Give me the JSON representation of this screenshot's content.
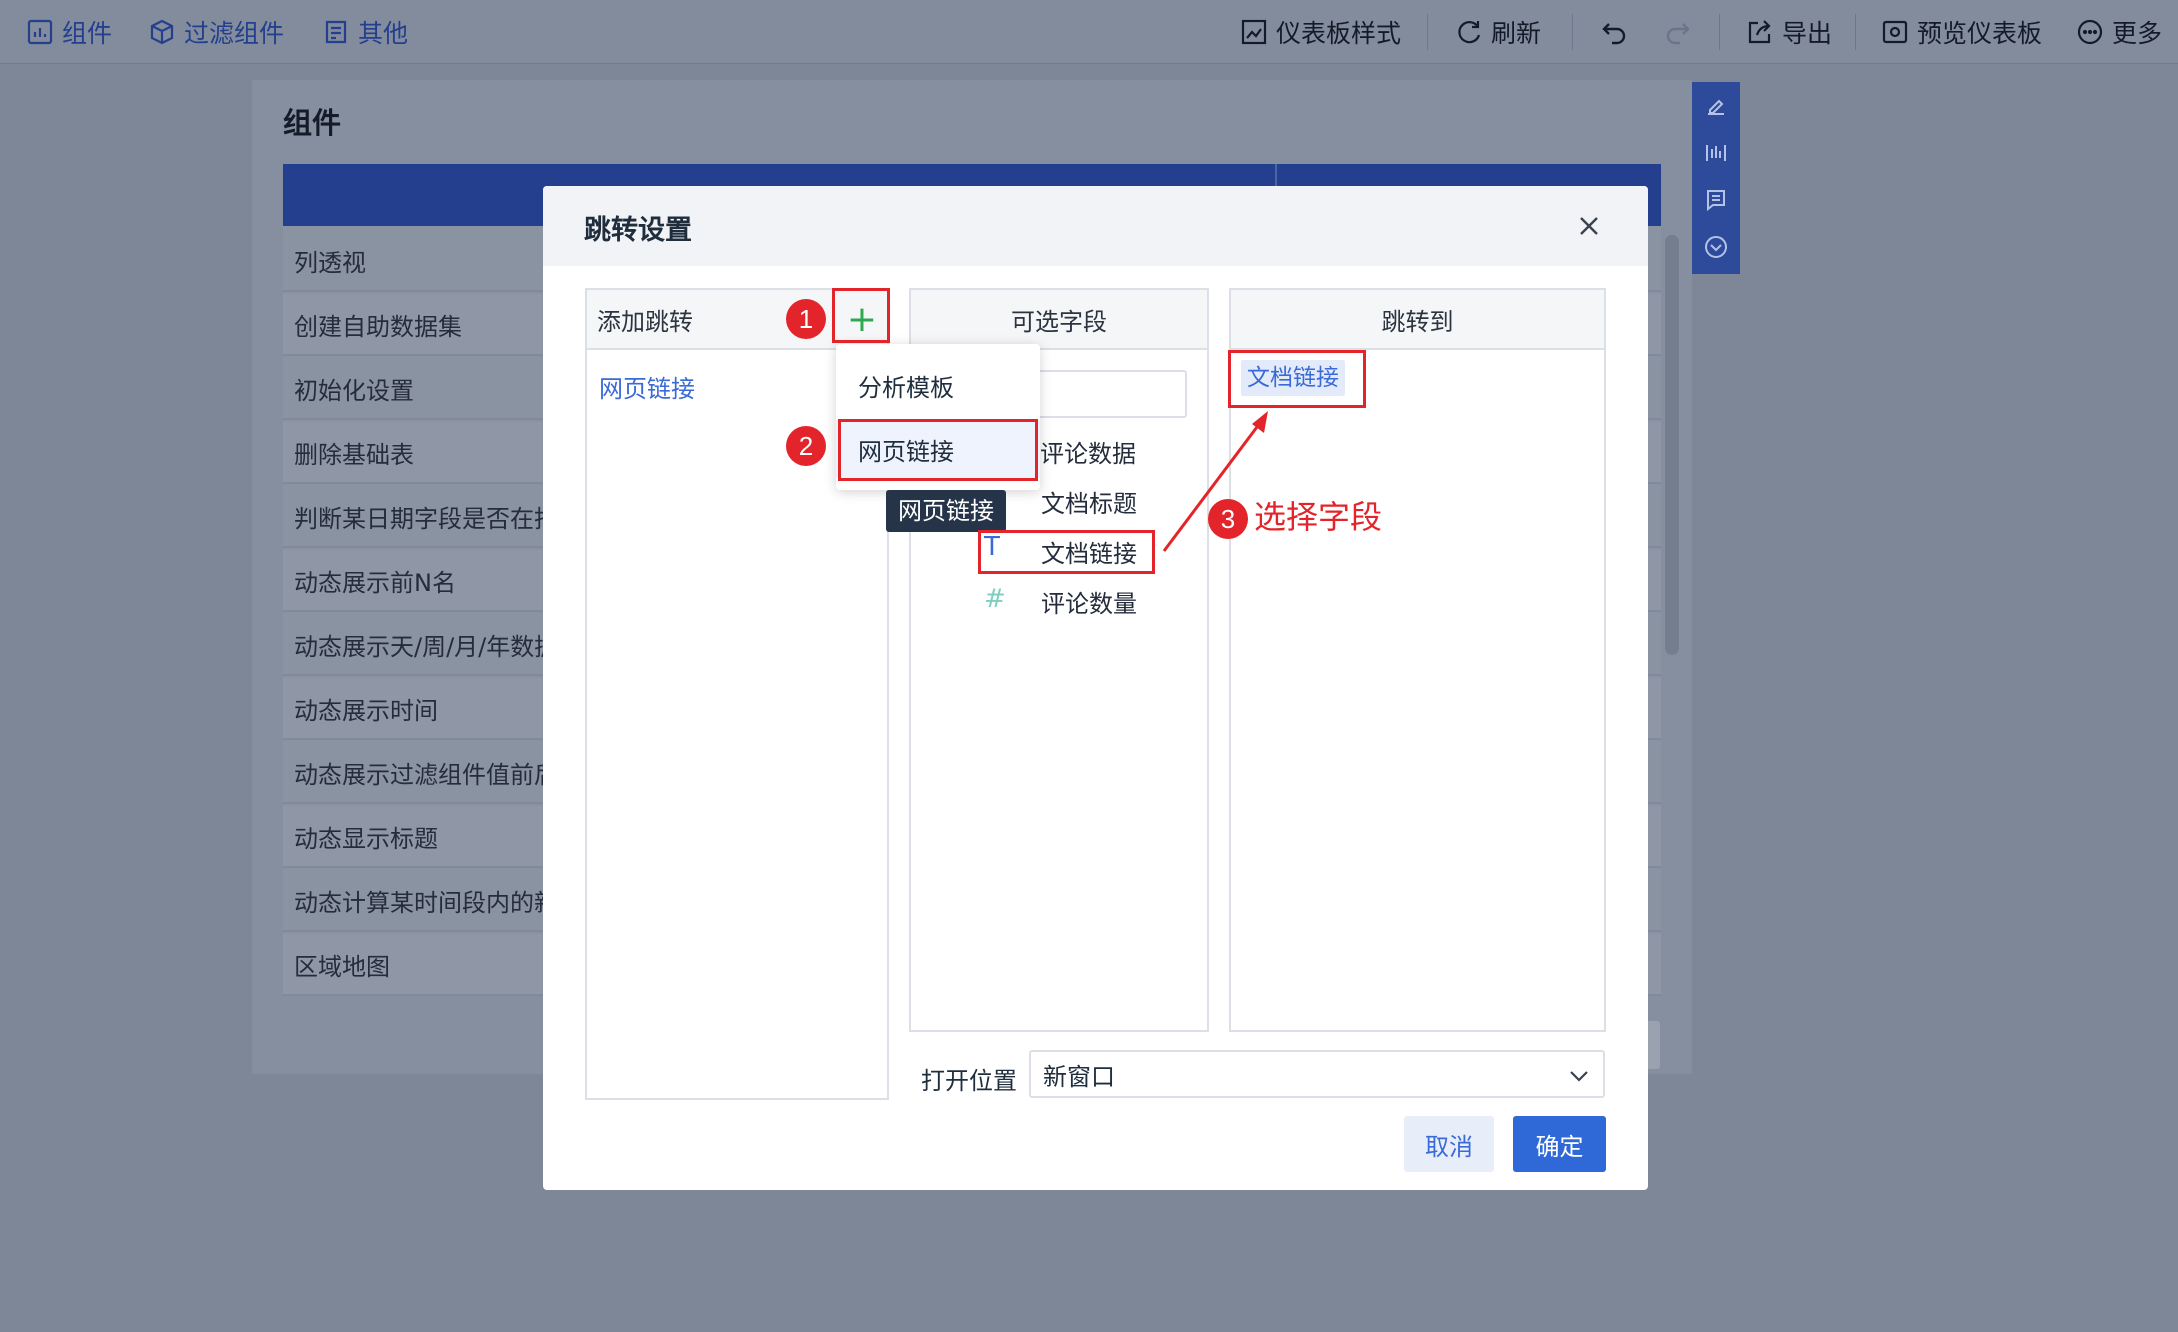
{
  "toolbar": {
    "left": [
      {
        "label": "组件",
        "icon": "chart-component-icon"
      },
      {
        "label": "过滤组件",
        "icon": "filter-component-icon"
      },
      {
        "label": "其他",
        "icon": "other-icon"
      }
    ],
    "right": [
      {
        "label": "仪表板样式",
        "icon": "dashboard-style-icon"
      },
      {
        "label": "刷新",
        "icon": "refresh-icon"
      },
      {
        "label": "导出",
        "icon": "export-icon"
      },
      {
        "label": "预览仪表板",
        "icon": "preview-icon"
      },
      {
        "label": "更多",
        "icon": "more-icon"
      }
    ],
    "undo_icon": "undo-icon",
    "redo_icon": "redo-icon"
  },
  "background_panel": {
    "title": "组件",
    "rows": [
      "列透视",
      "创建自助数据集",
      "初始化设置",
      "删除基础表",
      "判断某日期字段是否在指",
      "动态展示前N名",
      "动态展示天/周/月/年数据",
      "动态展示时间",
      "动态展示过滤组件值前后",
      "动态显示标题",
      "动态计算某时间段内的新",
      "区域地图"
    ]
  },
  "dialog": {
    "title": "跳转设置",
    "add_jump": {
      "header": "添加跳转",
      "items": [
        "网页链接"
      ]
    },
    "fields": {
      "header": "可选字段",
      "search_placeholder": "",
      "items": [
        {
          "label": "评论数据",
          "type": "",
          "partial_label": "评论数据"
        },
        {
          "label": "文档标题",
          "type": ""
        },
        {
          "label": "文档链接",
          "type": "text",
          "type_glyph": "T"
        },
        {
          "label": "评论数量",
          "type": "number",
          "type_glyph": "#"
        }
      ]
    },
    "jump_to": {
      "header": "跳转到",
      "tags": [
        "文档链接"
      ]
    },
    "dropdown": [
      "分析模板",
      "网页链接"
    ],
    "tooltip": "网页链接",
    "open_position": {
      "label": "打开位置",
      "value": "新窗口"
    },
    "buttons": {
      "cancel": "取消",
      "ok": "确定"
    }
  },
  "annotations": {
    "step1": "1",
    "step2": "2",
    "step3": "3",
    "step3_text": "选择字段"
  },
  "colors": {
    "accent": "#2f69d8",
    "link": "#3a6ad6",
    "annotation": "#e3242b",
    "number_icon": "#7fcfc0"
  }
}
